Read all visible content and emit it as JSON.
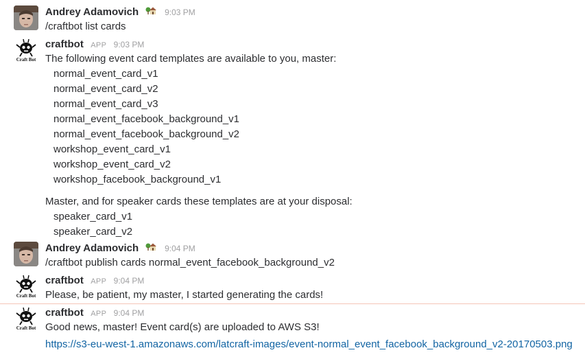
{
  "colors": {
    "link": "#1264a3",
    "divider": "#f4c5b8",
    "name": "#2c2d30",
    "meta": "#a0a0a2"
  },
  "messages": [
    {
      "author": "Andrey Adamovich",
      "status_icon": "house-with-garden-icon",
      "time": "9:03 PM",
      "lines": [
        "/craftbot list cards"
      ]
    },
    {
      "author": "craftbot",
      "app_badge": "APP",
      "avatar_label": "Craft Bot",
      "time": "9:03 PM",
      "intro": "The following event card templates are available to you, master:",
      "event_templates": [
        "normal_event_card_v1",
        "normal_event_card_v2",
        "normal_event_card_v3",
        "normal_event_facebook_background_v1",
        "normal_event_facebook_background_v2",
        "workshop_event_card_v1",
        "workshop_event_card_v2",
        "workshop_facebook_background_v1"
      ],
      "speaker_intro": "Master, and for speaker cards these templates are at your disposal:",
      "speaker_templates": [
        "speaker_card_v1",
        "speaker_card_v2"
      ]
    },
    {
      "author": "Andrey Adamovich",
      "status_icon": "house-with-garden-icon",
      "time": "9:04 PM",
      "lines": [
        "/craftbot publish cards normal_event_facebook_background_v2"
      ]
    },
    {
      "author": "craftbot",
      "app_badge": "APP",
      "avatar_label": "Craft Bot",
      "time": "9:04 PM",
      "lines": [
        "Please, be patient, my master, I started generating the cards!"
      ]
    },
    {
      "author": "craftbot",
      "app_badge": "APP",
      "avatar_label": "Craft Bot",
      "time": "9:04 PM",
      "lines": [
        "Good news, master! Event card(s) are uploaded to AWS S3!"
      ],
      "link": "https://s3-eu-west-1.amazonaws.com/latcraft-images/event-normal_event_facebook_background_v2-20170503.png"
    }
  ]
}
